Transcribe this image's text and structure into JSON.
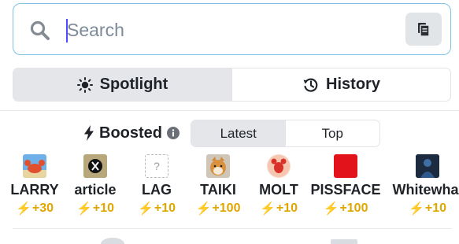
{
  "search": {
    "placeholder": "Search",
    "value": ""
  },
  "main_tabs": [
    {
      "label": "Spotlight",
      "icon": "sun-icon",
      "active": true
    },
    {
      "label": "History",
      "icon": "history-icon",
      "active": false
    }
  ],
  "boosted": {
    "title": "Boosted",
    "icons": [
      "bolt-icon",
      "info-icon"
    ],
    "tabs": [
      {
        "label": "Latest",
        "active": true
      },
      {
        "label": "Top",
        "active": false
      }
    ],
    "items": [
      {
        "name": "LARRY",
        "boost": "+30",
        "thumb": "crab-icon"
      },
      {
        "name": "article",
        "boost": "+10",
        "thumb": "x-logo-icon"
      },
      {
        "name": "LAG",
        "boost": "+10",
        "thumb": "unknown-token-icon"
      },
      {
        "name": "TAIKI",
        "boost": "+100",
        "thumb": "shiba-icon"
      },
      {
        "name": "MOLT",
        "boost": "+10",
        "thumb": "red-lobster-icon"
      },
      {
        "name": "PISSFACE",
        "boost": "+100",
        "thumb": "red-square-icon"
      },
      {
        "name": "Whitewhal",
        "boost": "+10",
        "thumb": "whale-figure-icon"
      }
    ]
  },
  "colors": {
    "accent_border": "#7ec3e8",
    "boost": "#e0a700",
    "active_segment": "#e4e6e9"
  }
}
